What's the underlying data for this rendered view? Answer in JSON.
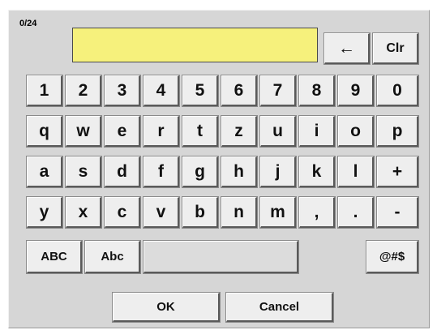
{
  "input": {
    "counter": "0/24",
    "value": ""
  },
  "controls": {
    "backspace": "←",
    "clear": "Clr"
  },
  "rows": [
    [
      "1",
      "2",
      "3",
      "4",
      "5",
      "6",
      "7",
      "8",
      "9",
      "0"
    ],
    [
      "q",
      "w",
      "e",
      "r",
      "t",
      "z",
      "u",
      "i",
      "o",
      "p"
    ],
    [
      "a",
      "s",
      "d",
      "f",
      "g",
      "h",
      "j",
      "k",
      "l",
      "+"
    ],
    [
      "y",
      "x",
      "c",
      "v",
      "b",
      "n",
      "m",
      ",",
      ".",
      "-"
    ]
  ],
  "bottom_row": {
    "caps": "ABC",
    "shift": "Abc",
    "space": "",
    "symbols": "@#$"
  },
  "actions": {
    "ok": "OK",
    "cancel": "Cancel"
  },
  "colors": {
    "panel": "#d6d6d6",
    "field": "#f6f17c",
    "key": "#eeeeee"
  }
}
